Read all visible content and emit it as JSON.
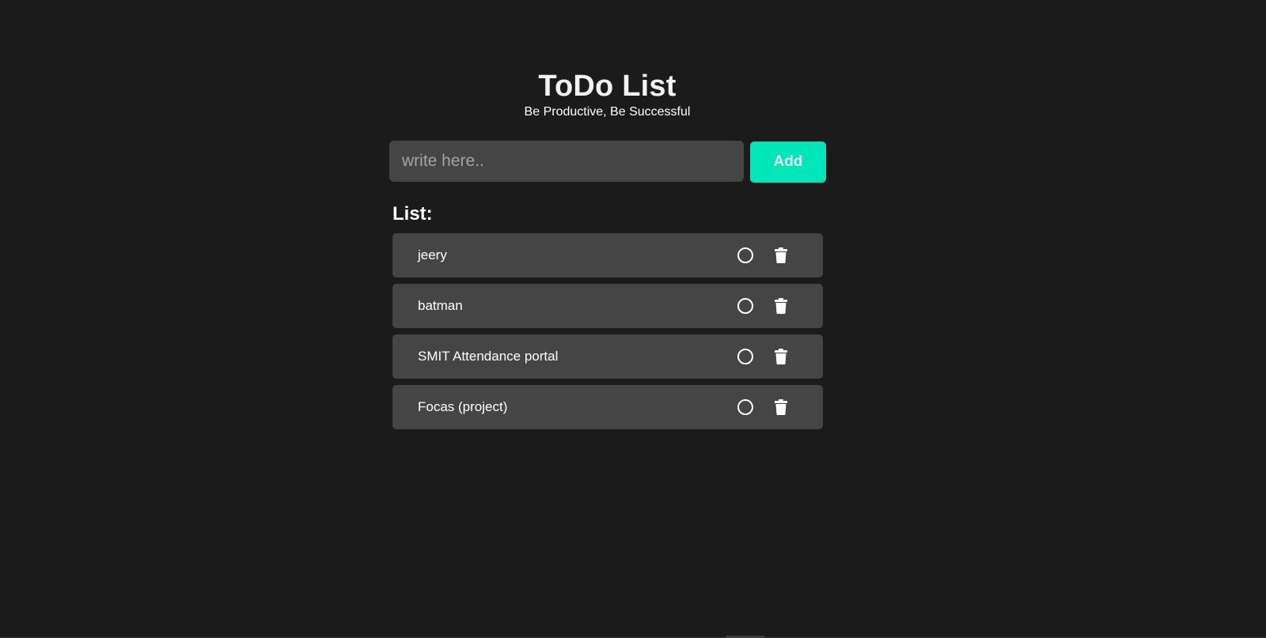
{
  "header": {
    "title": "ToDo List",
    "subtitle": "Be Productive, Be Successful"
  },
  "input": {
    "placeholder": "write here..",
    "value": ""
  },
  "add_button": {
    "label": "Add"
  },
  "list": {
    "heading": "List:",
    "items": [
      {
        "text": "jeery",
        "complete_icon": "circle-icon",
        "delete_icon": "trash-icon"
      },
      {
        "text": "batman",
        "complete_icon": "circle-icon",
        "delete_icon": "trash-icon"
      },
      {
        "text": "SMIT Attendance portal",
        "complete_icon": "circle-icon",
        "delete_icon": "trash-icon"
      },
      {
        "text": "Focas (project)",
        "complete_icon": "circle-icon",
        "delete_icon": "trash-icon"
      }
    ]
  },
  "colors": {
    "background": "#1b1b1b",
    "surface": "#454545",
    "accent": "#00e6b8",
    "text": "#ffffff"
  }
}
